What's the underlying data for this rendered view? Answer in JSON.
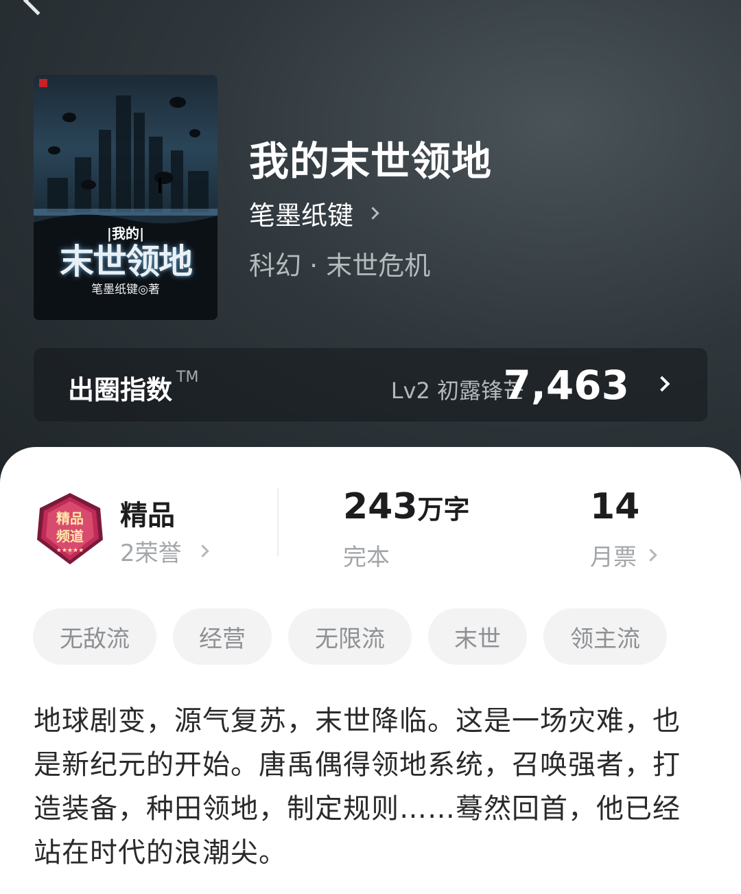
{
  "book": {
    "title": "我的末世领地",
    "author": "笔墨纸键",
    "genre": "科幻 · 末世危机",
    "cover": {
      "pre_title": "|我的|",
      "title": "末世领地",
      "author_line": "笔墨纸键◎著"
    }
  },
  "index": {
    "label": "出圈指数",
    "tm": "TM",
    "level": "Lv2 初露锋芒",
    "value": "7,463"
  },
  "stats": {
    "quality": {
      "title": "精品",
      "sub": "2荣誉",
      "medal_text": "精品频道"
    },
    "words": {
      "number": "243",
      "unit": "万字",
      "sub": "完本"
    },
    "votes": {
      "number": "14",
      "sub": "月票"
    }
  },
  "tags": [
    "无敌流",
    "经营",
    "无限流",
    "末世",
    "领主流"
  ],
  "description": "地球剧变，源气复苏，末世降临。这是一场灾难，也是新纪元的开始。唐禹偶得领地系统，召唤强者，打造装备，种田领地，制定规则……蓦然回首，他已经站在时代的浪潮尖。",
  "colors": {
    "hero_bg": "#2f373c",
    "medal": "#b8264f",
    "tag_bg": "#f3f3f3"
  }
}
